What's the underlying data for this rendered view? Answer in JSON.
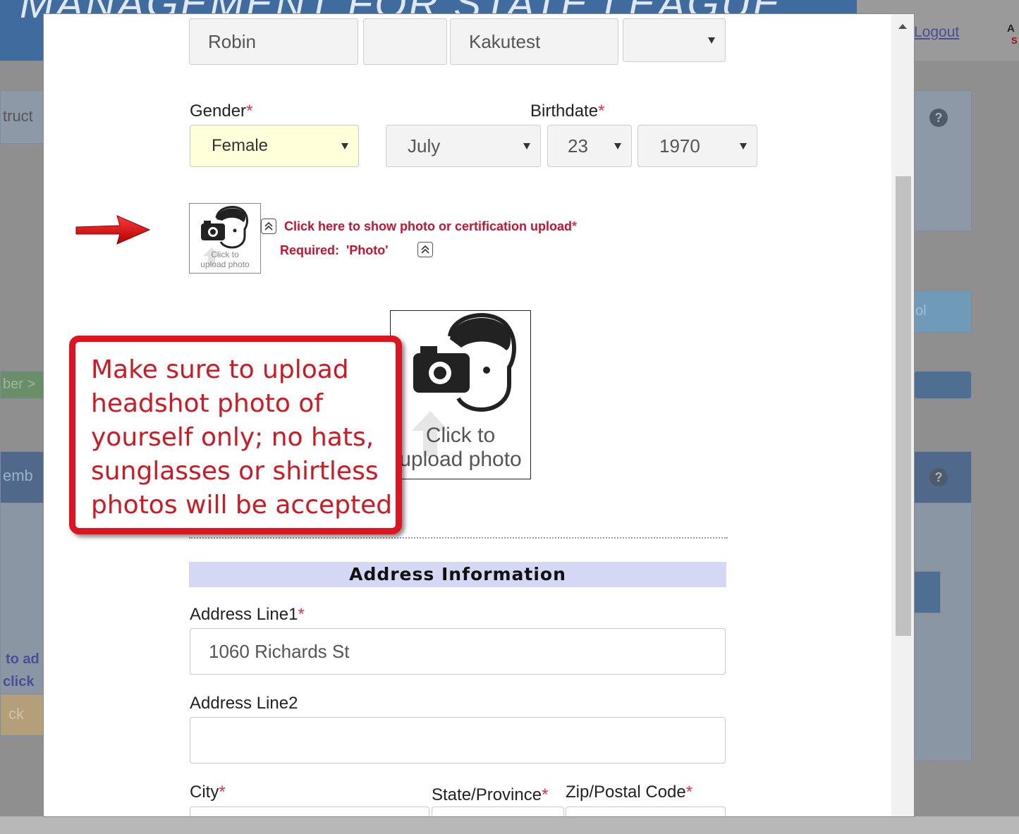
{
  "background": {
    "banner_title": "MANAGEMENT FOR STATE LEAGUE",
    "logout_link": "Logout",
    "corner_letter_a": "A",
    "corner_letter_s": "S",
    "fragment_instruct": "truct",
    "fragment_member_link": "ber >",
    "fragment_members": "emb",
    "fragment_to_ad": "to ad",
    "fragment_click": "click",
    "fragment_back": "ck",
    "fragment_tool": "ol"
  },
  "name_row": {
    "first_name": "Robin",
    "middle_name": "",
    "last_name": "Kakutest",
    "suffix": ""
  },
  "gender": {
    "label": "Gender",
    "required_mark": "*",
    "value": "Female"
  },
  "birthdate": {
    "label": "Birthdate",
    "required_mark": "*",
    "month": "July",
    "day": "23",
    "year": "1970"
  },
  "photo_upload": {
    "small_caption_line1": "Click to",
    "small_caption_line2": "upload photo",
    "show_link": "Click here to show photo or certification upload",
    "show_link_required_mark": "*",
    "required_text": "Required:  'Photo'",
    "big_caption_line1": "Click to",
    "big_caption_line2": "upload photo"
  },
  "callout": {
    "text": "Make sure to upload\nheadshot photo of\nyourself only; no hats,\nsunglasses or shirtless\nphotos will be accepted"
  },
  "address": {
    "section_title": "Address Information",
    "line1_label": "Address Line1",
    "line1_required_mark": "*",
    "line1_value": "1060 Richards St",
    "line2_label": "Address Line2",
    "line2_value": "",
    "city_label": "City",
    "city_required_mark": "*",
    "state_label": "State/Province",
    "state_required_mark": "*",
    "zip_label": "Zip/Postal Code",
    "zip_required_mark": "*"
  },
  "colors": {
    "required": "#e0314b",
    "callout_border": "#e0141e",
    "section_header_bg": "#d5d8f4",
    "gender_highlight": "#ffffd9"
  }
}
